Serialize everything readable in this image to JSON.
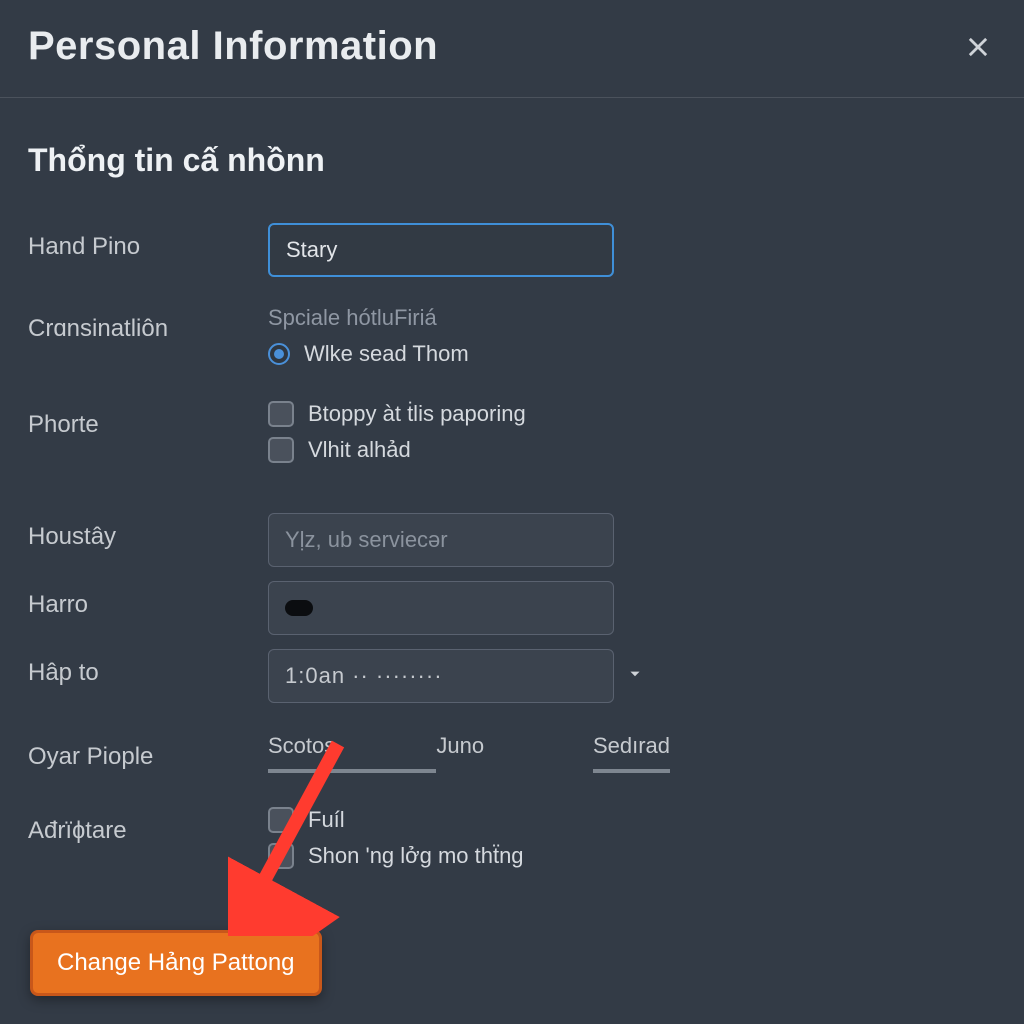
{
  "header": {
    "title": "Personal Information"
  },
  "section": {
    "title": "Thổng tin cấ nhồnn"
  },
  "fields": {
    "hand_pino": {
      "label": "Hand Pino",
      "value": "Stary"
    },
    "cransinatlion": {
      "label": "Crɑnsinatliôn",
      "helper": "Spciale hótluFiriá",
      "radio_label": "Wlke sead Thom"
    },
    "phorte": {
      "label": "Phorte",
      "opt1": "Btoppy àt ṫlis paporing",
      "opt2": "Vlhit alhảd"
    },
    "houstay": {
      "label": "Houstây",
      "placeholder": "Yḷz, ub serviecǝr"
    },
    "harro": {
      "label": "Harro"
    },
    "hap_to": {
      "label": "Hâp to",
      "value": "1:0an ·· ········"
    },
    "oyar_piople": {
      "label": "Oyar Piople",
      "tab1": "Scotos",
      "tab2": "Juno",
      "tab3": "Sedırad"
    },
    "adriptare": {
      "label": "Ađrïɸtare",
      "opt1": "Fuíl",
      "opt2": "Shon 'ng lởg mo thẗng"
    }
  },
  "actions": {
    "primary": "Change Hảng Pattong"
  },
  "colors": {
    "accent": "#e8721f",
    "focus": "#3f8fd8",
    "bg": "#333b46"
  }
}
